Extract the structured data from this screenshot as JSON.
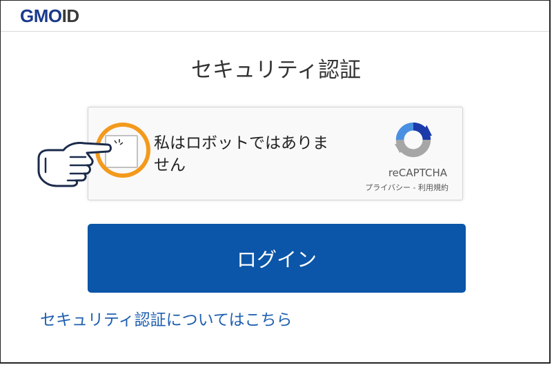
{
  "header": {
    "logo_main": "GMO",
    "logo_id": "ID"
  },
  "page": {
    "title": "セキュリティ認証"
  },
  "recaptcha": {
    "label": "私はロボットではありません",
    "brand": "reCAPTCHA",
    "privacy_link": "プライバシー",
    "separator": " - ",
    "terms_link": "利用規約",
    "checked": false
  },
  "login": {
    "label": "ログイン"
  },
  "footer_link": {
    "label": "セキュリティ認証についてはこちら"
  },
  "colors": {
    "brand_blue": "#1a3a8c",
    "button_blue": "#0b56a8",
    "link_blue": "#1f5fb0",
    "highlight_orange": "#f39a1c"
  },
  "icons": {
    "recaptcha_logo": "recaptcha-logo-icon",
    "pointing_hand": "pointing-hand-icon"
  }
}
